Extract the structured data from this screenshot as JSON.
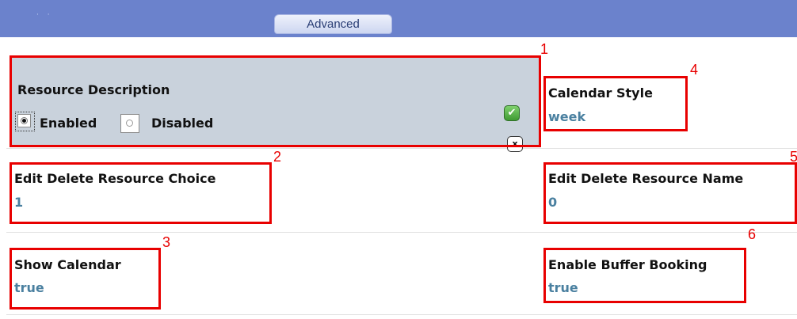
{
  "header": {
    "tab_label": "Advanced",
    "bar_color": "#6b82cc"
  },
  "fields": {
    "resource_description": {
      "label": "Resource Description",
      "options": [
        "Enabled",
        "Disabled"
      ],
      "selected": "Enabled"
    },
    "calendar_style": {
      "label": "Calendar Style",
      "value": "week"
    },
    "edit_delete_resource_choice": {
      "label": "Edit Delete Resource Choice",
      "value": "1"
    },
    "edit_delete_resource_name": {
      "label": "Edit Delete Resource Name",
      "value": "0"
    },
    "show_calendar": {
      "label": "Show Calendar",
      "value": "true"
    },
    "enable_buffer_booking": {
      "label": "Enable Buffer Booking",
      "value": "true"
    }
  },
  "callouts": [
    "1",
    "2",
    "3",
    "4",
    "5",
    "6"
  ],
  "icons": {
    "save": "checkmark-icon",
    "cancel": "x-icon"
  },
  "colors": {
    "highlight": "#e80000",
    "value_text": "#4a80a0",
    "edit_panel": "#c9d2dc"
  }
}
